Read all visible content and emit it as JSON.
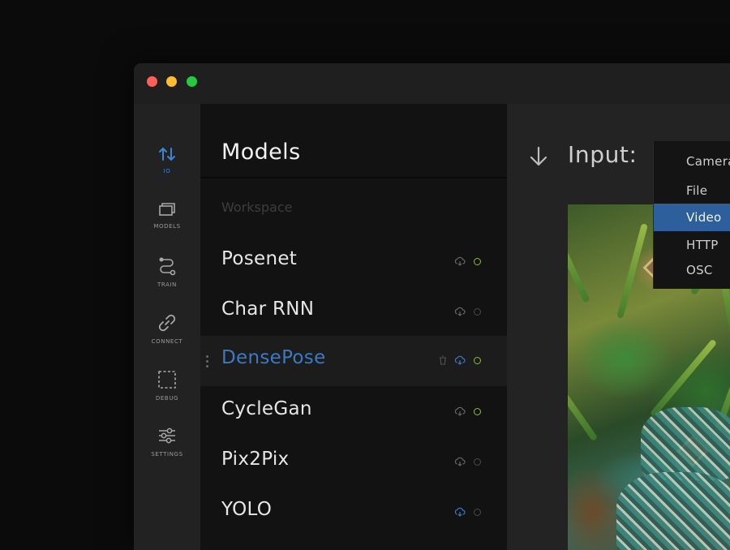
{
  "sidebar": {
    "items": [
      {
        "label": "IO",
        "icon": "swap-arrows-icon",
        "active": true
      },
      {
        "label": "MODELS",
        "icon": "stacked-windows-icon",
        "active": false
      },
      {
        "label": "TRAIN",
        "icon": "route-icon",
        "active": false
      },
      {
        "label": "CONNECT",
        "icon": "link-icon",
        "active": false
      },
      {
        "label": "DEBUG",
        "icon": "dashed-square-icon",
        "active": false
      },
      {
        "label": "SETTINGS",
        "icon": "sliders-icon",
        "active": false
      }
    ]
  },
  "models": {
    "title": "Models",
    "section": "Workspace",
    "items": [
      {
        "name": "Posenet",
        "status": "active",
        "cloud": "grey"
      },
      {
        "name": "Char RNN",
        "status": "inactive",
        "cloud": "grey"
      },
      {
        "name": "DensePose",
        "status": "active",
        "cloud": "blue",
        "selected": true,
        "has_trash": true
      },
      {
        "name": "CycleGan",
        "status": "active",
        "cloud": "grey"
      },
      {
        "name": "Pix2Pix",
        "status": "inactive",
        "cloud": "grey"
      },
      {
        "name": "YOLO",
        "status": "inactive",
        "cloud": "blue"
      }
    ]
  },
  "main": {
    "input_label": "Input:",
    "input_icon": "arrow-down-icon"
  },
  "dropdown": {
    "options": [
      "Camera",
      "File",
      "Video",
      "HTTP",
      "OSC"
    ],
    "selected": "Video"
  },
  "colors": {
    "accent": "#3a7ac5",
    "selected_option_bg": "#2d5f9c",
    "status_on": "#8fba3a",
    "traffic_red": "#ff5f57",
    "traffic_yellow": "#febc2e",
    "traffic_green": "#28c840"
  }
}
